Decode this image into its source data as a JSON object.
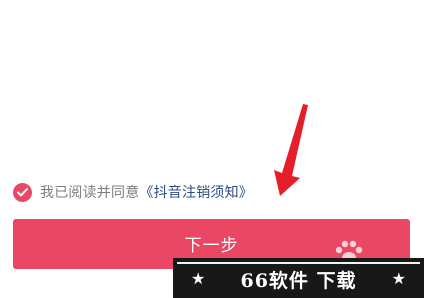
{
  "colors": {
    "accent": "#ea4764",
    "link": "#2e4b80",
    "muted_text": "#7d7d7d",
    "arrow": "#e51e2a",
    "watermark_bg": "#181818"
  },
  "agreement": {
    "checked": true,
    "check_icon": "checkmark-circle-icon",
    "prefix_text": "我已阅读并同意",
    "link_text": "《抖音注销须知》"
  },
  "next_button": {
    "label": "下一步"
  },
  "watermark": {
    "star_left": "★",
    "text": "66软件 下载",
    "star_right": "★",
    "paw_icon": "paw-icon"
  },
  "annotation": {
    "arrow_icon": "red-arrow-pointer"
  }
}
